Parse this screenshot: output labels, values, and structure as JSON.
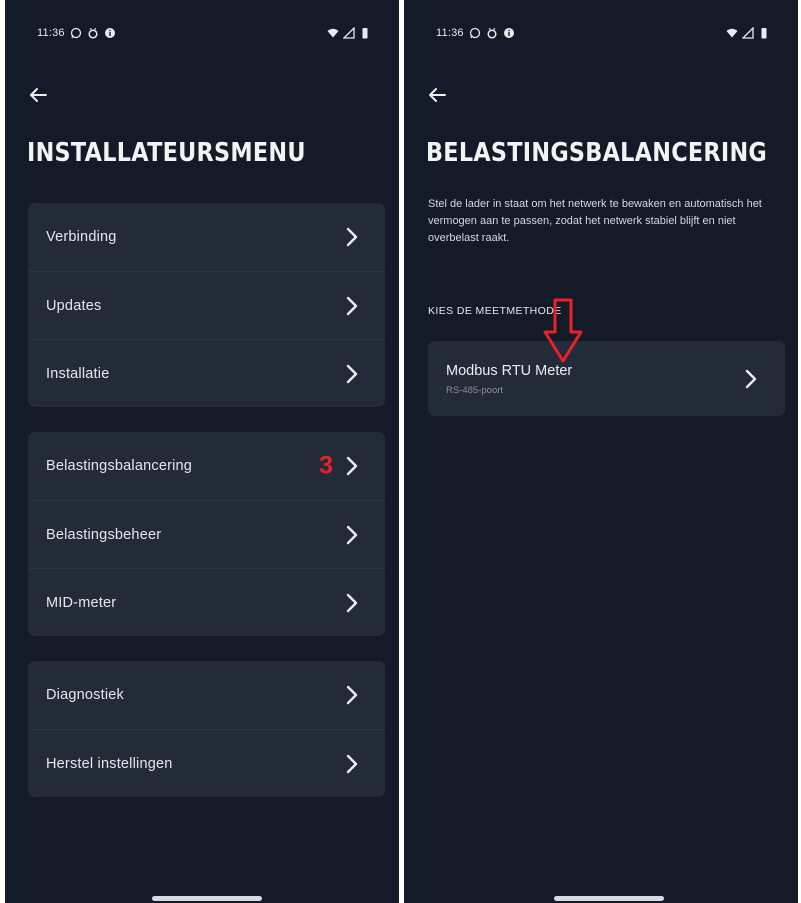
{
  "status_bar": {
    "time": "11:36",
    "icons_left": [
      "whatsapp-icon",
      "alarm-icon",
      "info-icon"
    ],
    "icons_right": [
      "wifi-icon",
      "signal-icon",
      "battery-icon"
    ]
  },
  "left_screen": {
    "title": "INSTALLATEURSMENU",
    "groups": [
      {
        "items": [
          {
            "label": "Verbinding"
          },
          {
            "label": "Updates"
          },
          {
            "label": "Installatie"
          }
        ]
      },
      {
        "items": [
          {
            "label": "Belastingsbalancering",
            "annotation": "3"
          },
          {
            "label": "Belastingsbeheer"
          },
          {
            "label": "MID-meter"
          }
        ]
      },
      {
        "items": [
          {
            "label": "Diagnostiek"
          },
          {
            "label": "Herstel instellingen"
          }
        ]
      }
    ]
  },
  "right_screen": {
    "title": "BELASTINGSBALANCERING",
    "description": "Stel de lader in staat om het netwerk te bewaken en automatisch het vermogen aan te passen, zodat het netwerk stabiel blijft en niet overbelast raakt.",
    "section_label": "KIES DE MEETMETHODE",
    "method": {
      "title": "Modbus RTU Meter",
      "subtitle": "RS-485-poort"
    }
  },
  "colors": {
    "background": "#141a28",
    "card": "#232a38",
    "text": "#e8eaee",
    "annotation_red": "#e8222a"
  }
}
